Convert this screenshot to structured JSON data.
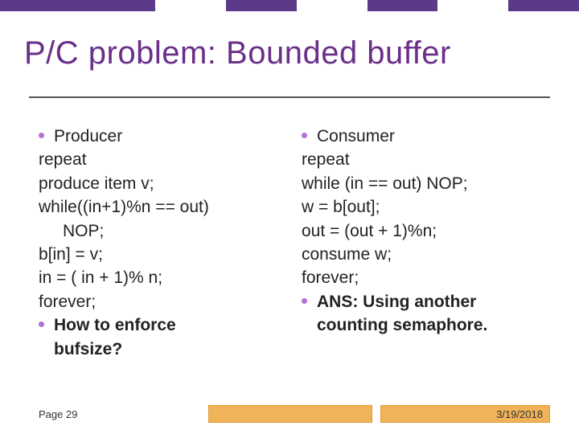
{
  "title": "P/C problem: Bounded buffer",
  "left": {
    "bullet1": "Producer",
    "l1": "repeat",
    "l2": "produce item v;",
    "l3a": "while((in+1)%n == out)",
    "l3b": "NOP;",
    "l4": "b[in] = v;",
    "l5": "in = ( in + 1)% n;",
    "l6": "forever;",
    "bullet2a": "How to enforce",
    "bullet2b": "bufsize?"
  },
  "right": {
    "bullet1": "Consumer",
    "l1": "repeat",
    "l2": "while (in == out) NOP;",
    "l3": "w = b[out];",
    "l4": "out = (out + 1)%n;",
    "l5": "consume w;",
    "l6": "forever;",
    "bullet2a": "ANS: Using another",
    "bullet2b": "counting semaphore."
  },
  "footer": {
    "page": "Page 29",
    "date": "3/19/2018"
  }
}
